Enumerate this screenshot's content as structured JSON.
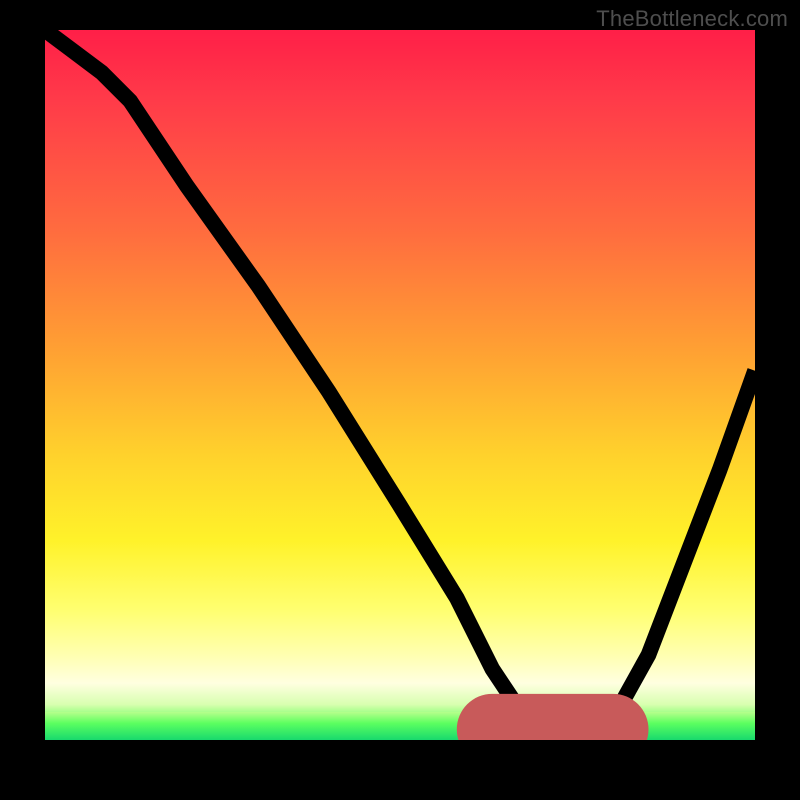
{
  "brand": "TheBottleneck.com",
  "chart_data": {
    "type": "line",
    "title": "",
    "xlabel": "",
    "ylabel": "",
    "xlim": [
      0,
      100
    ],
    "ylim": [
      0,
      100
    ],
    "grid": false,
    "legend": false,
    "series": [
      {
        "name": "bottleneck-curve",
        "x": [
          0,
          4,
          8,
          12,
          20,
          30,
          40,
          50,
          58,
          63,
          67,
          72,
          76,
          80,
          85,
          90,
          95,
          100
        ],
        "values": [
          100,
          97,
          94,
          90,
          78,
          64,
          49,
          33,
          20,
          10,
          4,
          1,
          1,
          3,
          12,
          25,
          38,
          52
        ]
      }
    ],
    "flat_region": {
      "x_start": 63,
      "x_end": 80,
      "y": 1.5
    },
    "background_gradient": {
      "top": "#ff1f48",
      "mid": "#ffd22c",
      "bottom": "#25e86f"
    }
  }
}
